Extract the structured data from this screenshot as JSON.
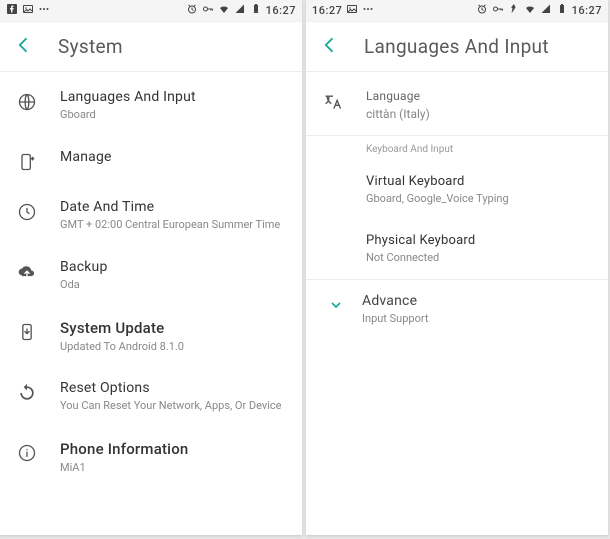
{
  "status": {
    "time": "16:27",
    "time_right": "16:27"
  },
  "left": {
    "title": "System",
    "items": [
      {
        "title": "Languages And Input",
        "sub": "Gboard"
      },
      {
        "title": "Manage",
        "sub": ""
      },
      {
        "title": "Date And Time",
        "sub": "GMT + 02:00 Central European Summer Time"
      },
      {
        "title": "Backup",
        "sub": "Oda"
      },
      {
        "title": "System Update",
        "sub": "Updated To Android 8.1.0"
      },
      {
        "title": "Reset Options",
        "sub": "You Can Reset Your Network, Apps, Or Device"
      },
      {
        "title": "Phone Information",
        "sub": "MiA1"
      }
    ]
  },
  "right": {
    "title": "Languages And Input",
    "language": {
      "label": "Language",
      "value": "cittàn (Italy)"
    },
    "section": "Keyboard And Input",
    "virtual": {
      "label": "Virtual Keyboard",
      "value": "Gboard, Google_Voice Typing"
    },
    "physical": {
      "label": "Physical Keyboard",
      "value": "Not Connected"
    },
    "advance": {
      "label": "Advance",
      "value": "Input Support"
    }
  }
}
